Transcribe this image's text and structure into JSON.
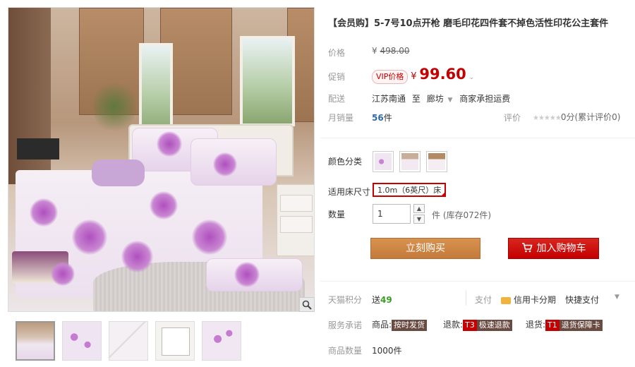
{
  "title": "【会员购】5-7号10点开枪 磨毛印花四件套不掉色活性印花公主套件",
  "price": {
    "label": "价格",
    "currency": "¥",
    "original": "498.00"
  },
  "promo": {
    "label": "促销",
    "tag": "VIP价格",
    "currency": "¥",
    "value": "99.60"
  },
  "delivery": {
    "label": "配送",
    "from": "江苏南通",
    "to_word": "至",
    "to": "廊坊",
    "note": "商家承担运费"
  },
  "sales": {
    "label": "月销量",
    "count": "56",
    "unit": "件",
    "rating_label": "评价",
    "stars": "★★★★★",
    "rating_text": "0分(累计评价0)"
  },
  "color": {
    "label": "颜色分类"
  },
  "size": {
    "label": "适用床尺寸",
    "selected": "1.0m（6英尺）床"
  },
  "quantity": {
    "label": "数量",
    "value": "1",
    "stock": "件 (库存072件)"
  },
  "buttons": {
    "buy": "立刻购买",
    "cart": "加入购物车"
  },
  "points": {
    "label": "天猫积分",
    "send": "送",
    "value": "49",
    "pay_label": "支付",
    "credit": "信用卡分期",
    "quick": "快捷支付"
  },
  "service": {
    "label": "服务承诺",
    "goods": "商品:",
    "goods_tag": "按时发货",
    "refund": "退款:",
    "refund_code": "T3",
    "refund_tag": "极速退款",
    "return": "退货:",
    "return_code": "T1",
    "return_tag": "退货保障卡"
  },
  "inventory": {
    "label": "商品数量",
    "value": "1000件"
  },
  "colors": {
    "accent": "#c40000",
    "buy_button": "#c98241",
    "points_green": "#3a9d23"
  },
  "icons": [
    "zoom-icon",
    "cart-icon",
    "card-icon",
    "chevron-down-icon",
    "star-icon"
  ]
}
